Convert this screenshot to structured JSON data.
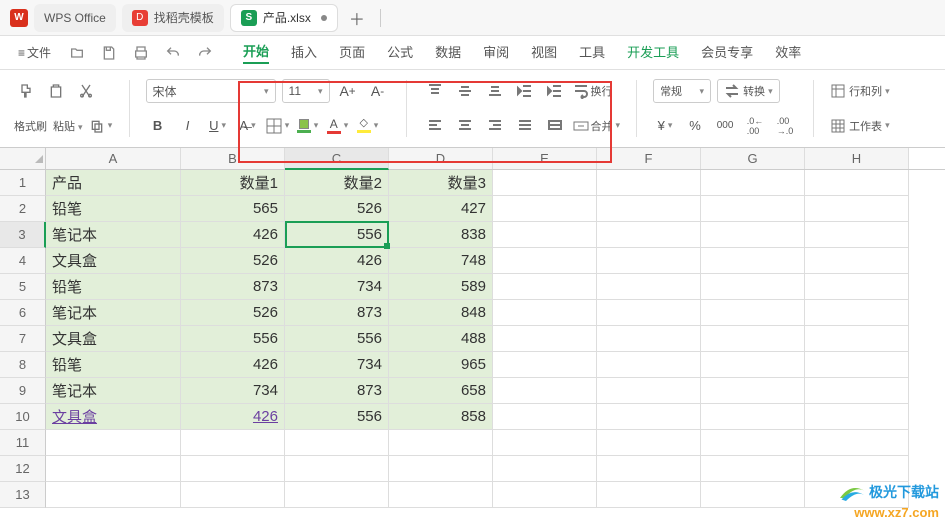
{
  "titlebar": {
    "app_name": "WPS Office",
    "tab_template": "找稻壳模板",
    "tab_active": "产品.xlsx"
  },
  "menubar": {
    "file": "文件",
    "tabs": {
      "start": "开始",
      "insert": "插入",
      "page": "页面",
      "formula": "公式",
      "data": "数据",
      "review": "审阅",
      "view": "视图",
      "tools": "工具",
      "dev": "开发工具",
      "vip": "会员专享",
      "efficiency": "效率"
    }
  },
  "ribbon": {
    "format_painter": "格式刷",
    "paste": "粘贴",
    "font_name": "宋体",
    "font_size": "11",
    "wrap": "换行",
    "merge": "合并",
    "num_format": "常规",
    "convert": "转换",
    "rowcol": "行和列",
    "worksheet": "工作表"
  },
  "sheet": {
    "col_labels": [
      "A",
      "B",
      "C",
      "D",
      "E",
      "F",
      "G",
      "H"
    ],
    "row_labels": [
      "1",
      "2",
      "3",
      "4",
      "5",
      "6",
      "7",
      "8",
      "9",
      "10",
      "11",
      "12",
      "13"
    ],
    "headers": {
      "a": "产品",
      "b": "数量1",
      "c": "数量2",
      "d": "数量3"
    },
    "rows": [
      {
        "a": "铅笔",
        "b": "565",
        "c": "526",
        "d": "427"
      },
      {
        "a": "笔记本",
        "b": "426",
        "c": "556",
        "d": "838"
      },
      {
        "a": "文具盒",
        "b": "526",
        "c": "426",
        "d": "748"
      },
      {
        "a": "铅笔",
        "b": "873",
        "c": "734",
        "d": "589"
      },
      {
        "a": "笔记本",
        "b": "526",
        "c": "873",
        "d": "848"
      },
      {
        "a": "文具盒",
        "b": "556",
        "c": "556",
        "d": "488"
      },
      {
        "a": "铅笔",
        "b": "426",
        "c": "734",
        "d": "965"
      },
      {
        "a": "笔记本",
        "b": "734",
        "c": "873",
        "d": "658"
      },
      {
        "a": "文具盒",
        "b": "426",
        "c": "556",
        "d": "858"
      }
    ]
  },
  "watermark": {
    "title": "极光下载站",
    "url": "www.xz7.com"
  }
}
